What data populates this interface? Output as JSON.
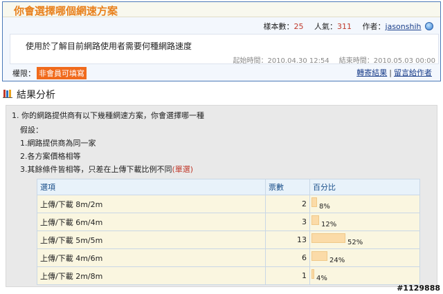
{
  "survey": {
    "title": "你會選擇哪個網速方案",
    "sample_label": "樣本數：",
    "sample_value": "25",
    "popularity_label": "人氣：",
    "popularity_value": "311",
    "author_label": "作者：",
    "author_name": "jasonshih",
    "description": "使用於了解目前網路使用者需要何種網路速度",
    "start_time": "起始時間：2010.04.30 12:54",
    "end_time": "結束時間：2010.05.03 00:00",
    "permission_label": "權限：",
    "permission_badge": "非會員可填寫",
    "link_forward": "轉寄結果",
    "link_separator": "|",
    "link_comment": "留言給作者"
  },
  "results": {
    "header": "結果分析",
    "question_lines": [
      "1. 你的網路提供商有以下幾種網速方案，你會選擇哪一種",
      "假設：",
      "1.網路提供商為同一家",
      "2.各方案價格相等",
      "3.其餘條件皆相等，只差在上傳下載比例不同"
    ],
    "question_type": "(單選)",
    "table": {
      "headers": [
        "選項",
        "票數",
        "百分比"
      ],
      "rows": [
        {
          "option": "上傳/下載 8m/2m",
          "votes": "2",
          "percent_text": "8%",
          "percent": 8
        },
        {
          "option": "上傳/下載 6m/4m",
          "votes": "3",
          "percent_text": "12%",
          "percent": 12
        },
        {
          "option": "上傳/下載 5m/5m",
          "votes": "13",
          "percent_text": "52%",
          "percent": 52
        },
        {
          "option": "上傳/下載 4m/6m",
          "votes": "6",
          "percent_text": "24%",
          "percent": 24
        },
        {
          "option": "上傳/下載 2m/8m",
          "votes": "1",
          "percent_text": "4%",
          "percent": 4
        }
      ]
    }
  },
  "watermark": "#1129888",
  "colors": {
    "title_orange": "#e8801c",
    "stat_red": "#c0392b",
    "link_blue": "#1a3e8a",
    "badge_orange": "#f06a1c",
    "bar_fill": "#fbdba8"
  }
}
